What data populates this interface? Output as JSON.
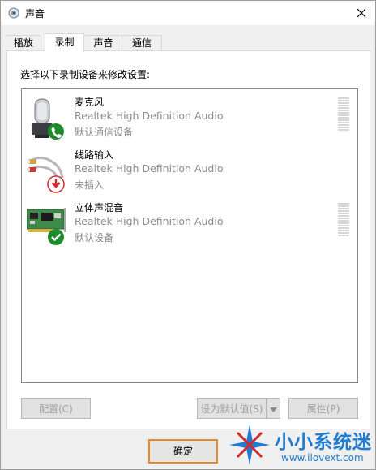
{
  "window": {
    "title": "声音",
    "title_icon": "speaker-icon",
    "close_icon": "close-icon"
  },
  "tabs": [
    {
      "label": "播放",
      "active": false
    },
    {
      "label": "录制",
      "active": true
    },
    {
      "label": "声音",
      "active": false
    },
    {
      "label": "通信",
      "active": false
    }
  ],
  "panel": {
    "instruction": "选择以下录制设备来修改设置:"
  },
  "devices": [
    {
      "name": "麦克风",
      "description": "Realtek High Definition Audio",
      "status": "默认通信设备",
      "icon": "microphone-icon",
      "badge": "phone-badge-icon",
      "badge_color": "#1e8c2c"
    },
    {
      "name": "线路输入",
      "description": "Realtek High Definition Audio",
      "status": "未插入",
      "icon": "line-in-cable-icon",
      "badge": "down-arrow-badge-icon",
      "badge_color": "#d22b2b"
    },
    {
      "name": "立体声混音",
      "description": "Realtek High Definition Audio",
      "status": "默认设备",
      "icon": "sound-card-icon",
      "badge": "checkmark-badge-icon",
      "badge_color": "#1e8c2c"
    }
  ],
  "buttons": {
    "configure": "配置(C)",
    "set_default": "设为默认值(S)",
    "properties": "属性(P)",
    "ok": "确定"
  },
  "watermark": {
    "name": "小小系统迷",
    "url": "www.ilovext.com",
    "brand_color": "#1f7cd0"
  }
}
